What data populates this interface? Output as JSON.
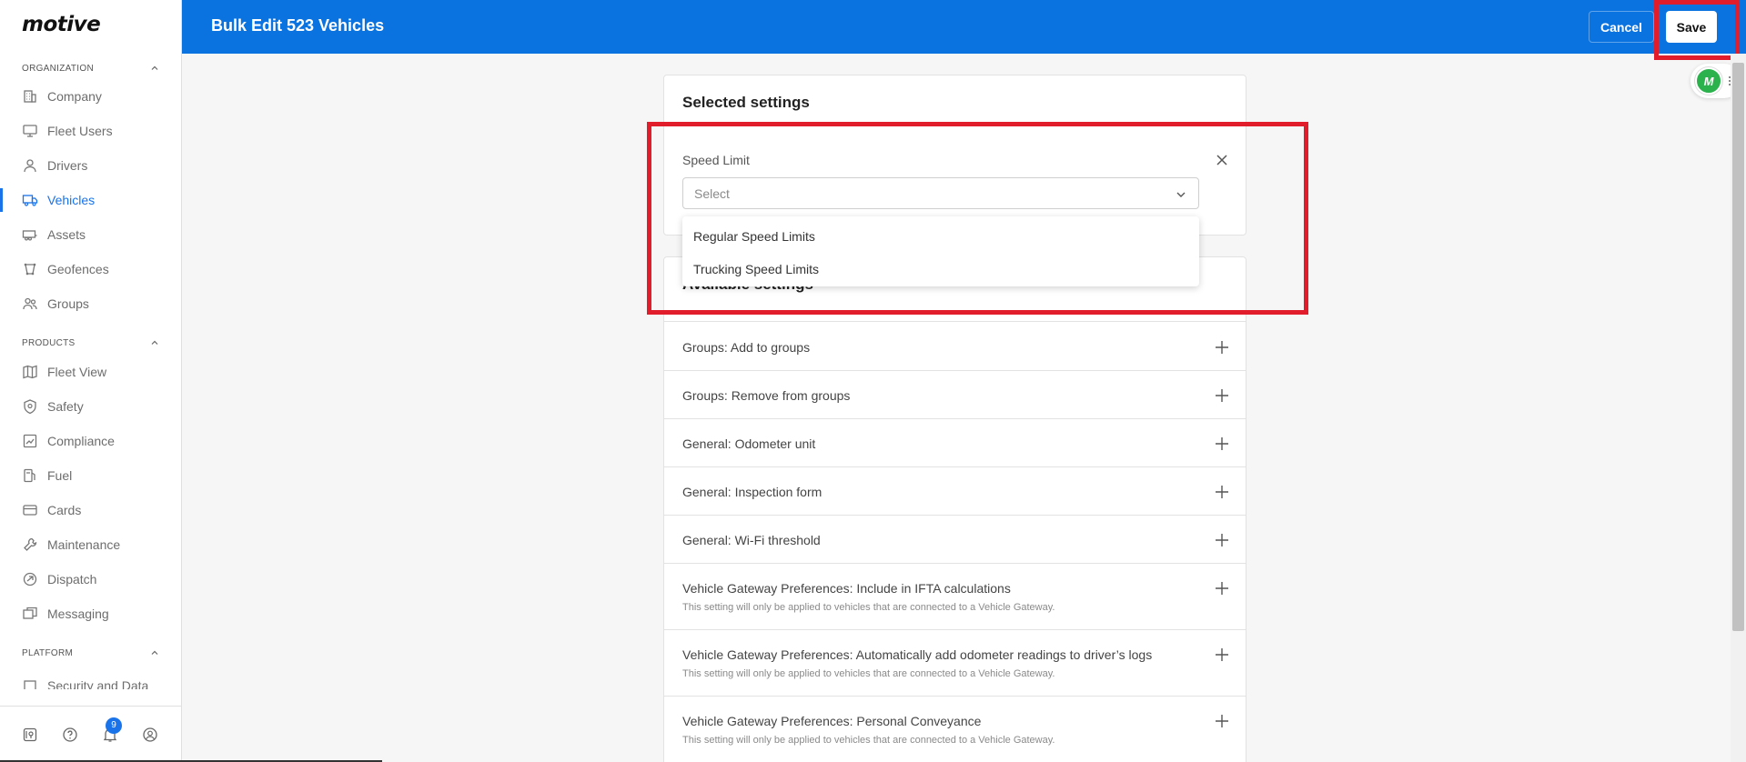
{
  "brand": "motive",
  "header": {
    "title": "Bulk Edit 523 Vehicles",
    "cancel_label": "Cancel",
    "save_label": "Save"
  },
  "sidebar": {
    "sections": [
      {
        "label": "ORGANIZATION",
        "items": [
          {
            "label": "Company",
            "icon": "building-icon"
          },
          {
            "label": "Fleet Users",
            "icon": "monitor-icon"
          },
          {
            "label": "Drivers",
            "icon": "person-icon"
          },
          {
            "label": "Vehicles",
            "icon": "truck-icon",
            "active": true
          },
          {
            "label": "Assets",
            "icon": "trailer-icon"
          },
          {
            "label": "Geofences",
            "icon": "geofence-icon"
          },
          {
            "label": "Groups",
            "icon": "users-icon"
          }
        ]
      },
      {
        "label": "PRODUCTS",
        "items": [
          {
            "label": "Fleet View",
            "icon": "map-icon"
          },
          {
            "label": "Safety",
            "icon": "shield-icon"
          },
          {
            "label": "Compliance",
            "icon": "chart-icon"
          },
          {
            "label": "Fuel",
            "icon": "fuel-icon"
          },
          {
            "label": "Cards",
            "icon": "card-icon"
          },
          {
            "label": "Maintenance",
            "icon": "wrench-icon"
          },
          {
            "label": "Dispatch",
            "icon": "dispatch-icon"
          },
          {
            "label": "Messaging",
            "icon": "message-icon"
          }
        ]
      },
      {
        "label": "PLATFORM",
        "items": [
          {
            "label": "Security and Data",
            "icon": "lock-icon"
          }
        ]
      }
    ],
    "notification_count": "9"
  },
  "selected": {
    "title": "Selected settings",
    "field_label": "Speed Limit",
    "select_placeholder": "Select",
    "options": [
      "Regular Speed Limits",
      "Trucking Speed Limits"
    ]
  },
  "available": {
    "title": "Available settings",
    "rows": [
      {
        "label": "Groups: Add to groups",
        "sub": ""
      },
      {
        "label": "Groups: Remove from groups",
        "sub": ""
      },
      {
        "label": "General: Odometer unit",
        "sub": ""
      },
      {
        "label": "General: Inspection form",
        "sub": ""
      },
      {
        "label": "General: Wi-Fi threshold",
        "sub": ""
      },
      {
        "label": "Vehicle Gateway Preferences: Include in IFTA calculations",
        "sub": "This setting will only be applied to vehicles that are connected to a Vehicle Gateway."
      },
      {
        "label": "Vehicle Gateway Preferences: Automatically add odometer readings to driver’s logs",
        "sub": "This setting will only be applied to vehicles that are connected to a Vehicle Gateway."
      },
      {
        "label": "Vehicle Gateway Preferences: Personal Conveyance",
        "sub": "This setting will only be applied to vehicles that are connected to a Vehicle Gateway."
      }
    ]
  },
  "colors": {
    "accent": "#0a73e0",
    "highlight": "#e21d2b",
    "avatar": "#2bb24c"
  },
  "avatar_initials": "M"
}
